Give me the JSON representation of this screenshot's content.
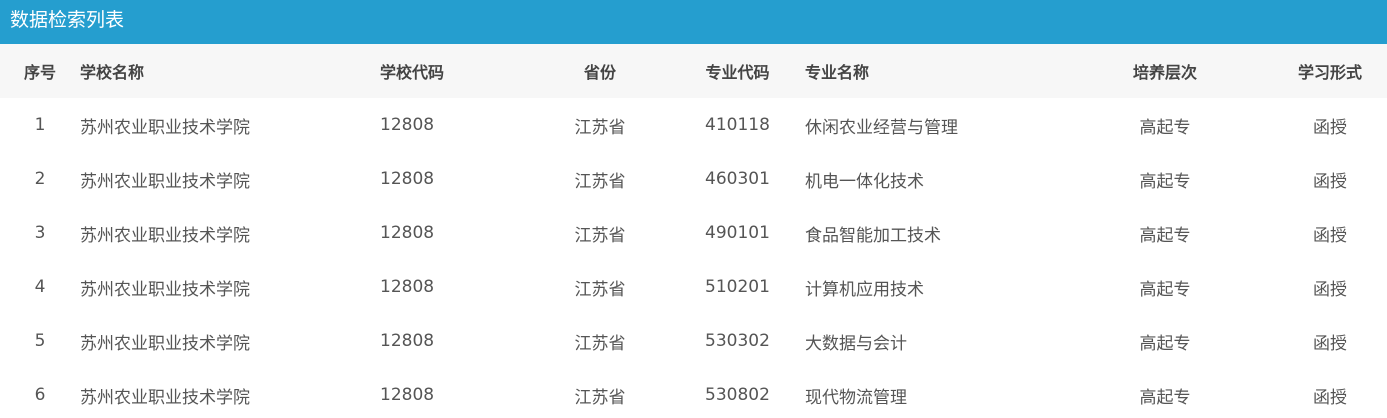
{
  "title": "数据检索列表",
  "columns": [
    "序号",
    "学校名称",
    "学校代码",
    "省份",
    "专业代码",
    "专业名称",
    "培养层次",
    "学习形式"
  ],
  "rows": [
    [
      "1",
      "苏州农业职业技术学院",
      "12808",
      "江苏省",
      "410118",
      "休闲农业经营与管理",
      "高起专",
      "函授"
    ],
    [
      "2",
      "苏州农业职业技术学院",
      "12808",
      "江苏省",
      "460301",
      "机电一体化技术",
      "高起专",
      "函授"
    ],
    [
      "3",
      "苏州农业职业技术学院",
      "12808",
      "江苏省",
      "490101",
      "食品智能加工技术",
      "高起专",
      "函授"
    ],
    [
      "4",
      "苏州农业职业技术学院",
      "12808",
      "江苏省",
      "510201",
      "计算机应用技术",
      "高起专",
      "函授"
    ],
    [
      "5",
      "苏州农业职业技术学院",
      "12808",
      "江苏省",
      "530302",
      "大数据与会计",
      "高起专",
      "函授"
    ],
    [
      "6",
      "苏州农业职业技术学院",
      "12808",
      "江苏省",
      "530802",
      "现代物流管理",
      "高起专",
      "函授"
    ]
  ],
  "colors": {
    "title_bar": "#259ecf",
    "header_bg": "#f7f7f7"
  }
}
